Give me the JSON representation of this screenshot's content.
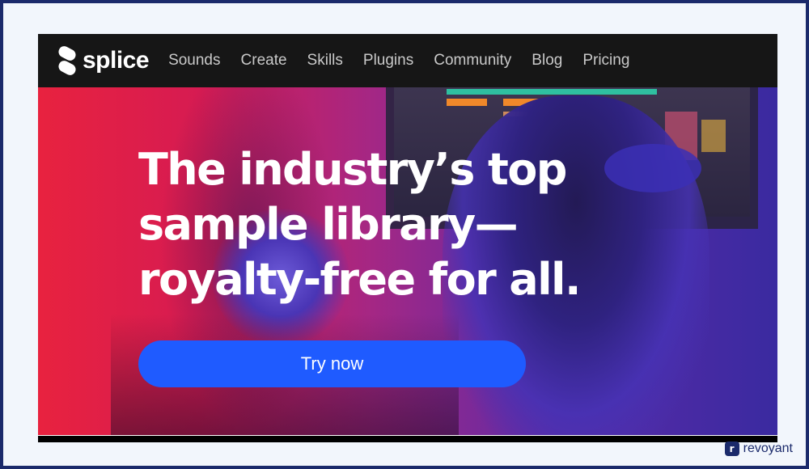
{
  "site": {
    "logo_text": "splice",
    "nav": [
      {
        "label": "Sounds"
      },
      {
        "label": "Create"
      },
      {
        "label": "Skills"
      },
      {
        "label": "Plugins"
      },
      {
        "label": "Community"
      },
      {
        "label": "Blog"
      },
      {
        "label": "Pricing"
      }
    ]
  },
  "hero": {
    "headline_lines": [
      "The industry’s top",
      "sample library—",
      "royalty-free for all."
    ],
    "cta_label": "Try now"
  },
  "watermark": {
    "mark": "r",
    "text": "revoyant"
  },
  "colors": {
    "accent": "#1f5bff",
    "navbar": "#161616",
    "frame_border": "#1b2a6b"
  }
}
